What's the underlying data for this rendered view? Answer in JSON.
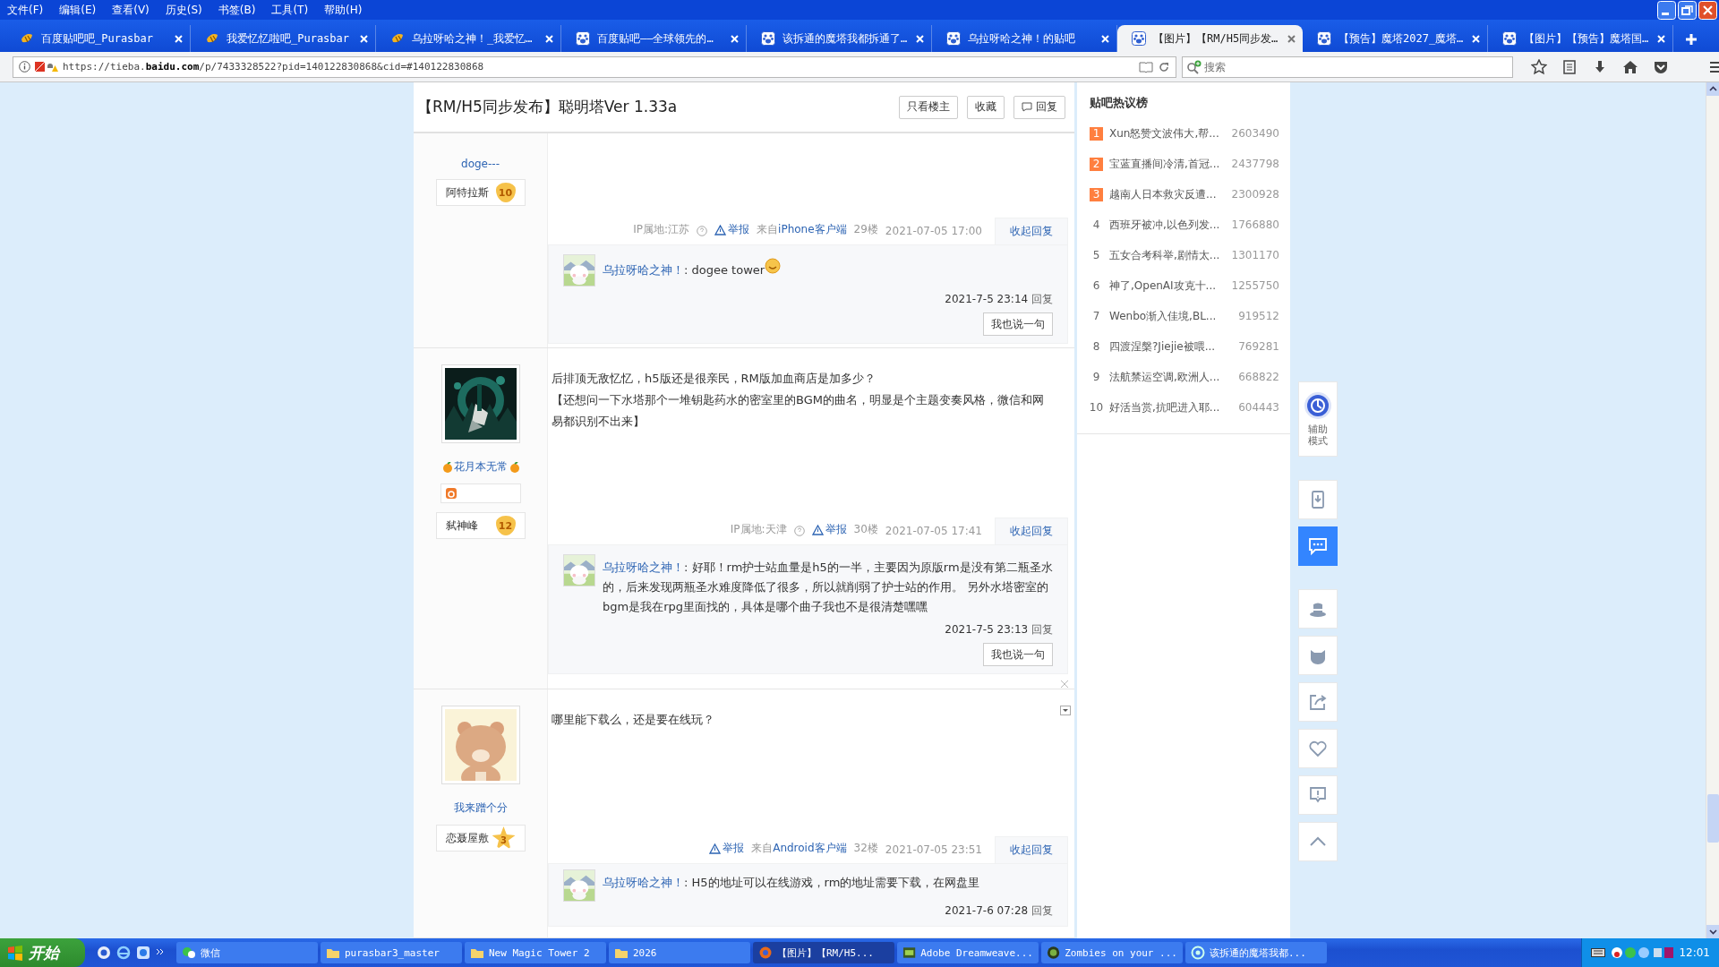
{
  "menu_bar": {
    "items": [
      "文件(F)",
      "编辑(E)",
      "查看(V)",
      "历史(S)",
      "书签(B)",
      "工具(T)",
      "帮助(H)"
    ]
  },
  "tabs": [
    {
      "title": "百度贴吧吧_Purasbar",
      "kind": "bee",
      "selected": false
    },
    {
      "title": "我爱忆忆啦吧_Purasbar",
      "kind": "bee",
      "selected": false
    },
    {
      "title": "乌拉呀哈之神！_我爱忆…",
      "kind": "bee",
      "selected": false
    },
    {
      "title": "百度贴吧——全球领先的…",
      "kind": "paw",
      "selected": false
    },
    {
      "title": "该拆通的魔塔我都拆通了…",
      "kind": "paw",
      "selected": false
    },
    {
      "title": "乌拉呀哈之神！的贴吧",
      "kind": "paw",
      "selected": false
    },
    {
      "title": "【图片】【RM/H5同步发…",
      "kind": "paw",
      "selected": true
    },
    {
      "title": "【预告】魔塔2027_魔塔…",
      "kind": "paw",
      "selected": false
    },
    {
      "title": "【图片】【预告】魔塔国…",
      "kind": "paw",
      "selected": false
    }
  ],
  "nav_bar": {
    "url": "https://tieba.**baidu.com**/p/7433328522?pid=140122830868&cid=#140122830868",
    "search": {
      "placeholder": "搜索"
    }
  },
  "thread": {
    "title": "【RM/H5同步发布】聪明塔Ver 1.33a",
    "buttons": [
      {
        "label": "只看楼主",
        "kind": "text"
      },
      {
        "label": "收藏",
        "kind": "text"
      },
      {
        "label": "回复",
        "kind": "comment"
      }
    ],
    "posts": [
      {
        "author": "doge---",
        "avatar": false,
        "author_decor": false,
        "icon_shelf": false,
        "badge": {
          "name": "阿特拉斯",
          "level": "10",
          "kind": "shield"
        },
        "meta": {
          "ip": "IP属地:江苏",
          "report": "举报",
          "client": {
            "prefix": "来自",
            "name": "iPhone客户端"
          },
          "floor": "29楼",
          "time": "2021-07-05 17:00",
          "toggle": "收起回复"
        },
        "replies": [
          {
            "user": "乌拉呀哈之神！",
            "text": ": dogee tower",
            "emoji": true,
            "time": "2021-7-5 23:14",
            "action": "回复"
          }
        ],
        "comment_button": "我也说一句"
      },
      {
        "author": "花月本无常",
        "avatar": {
          "kind": "picture"
        },
        "author_decor": true,
        "icon_shelf": true,
        "badge": {
          "name": "弑神峰",
          "level": "12",
          "kind": "shield"
        },
        "text": [
          "后排顶无敌忆忆，h5版还是很亲民，RM版加血商店是加多少？",
          "【还想问一下水塔那个一堆钥匙药水的密室里的BGM的曲名，明显是个主题变奏风格，微信和网易都识别不出来】"
        ],
        "meta": {
          "ip": "IP属地:天津",
          "report": "举报",
          "floor": "30楼",
          "time": "2021-07-05 17:41",
          "toggle": "收起回复"
        },
        "replies": [
          {
            "user": "乌拉呀哈之神！",
            "text": ": 好耶！rm护士站血量是h5的一半，主要因为原版rm是没有第二瓶圣水的，后来发现两瓶圣水难度降低了很多，所以就削弱了护士站的作用。 另外水塔密室的bgm是我在rpg里面找的，具体是哪个曲子我也不是很清楚嘿嘿",
            "emoji": false,
            "time": "2021-7-5 23:13",
            "action": "回复"
          }
        ],
        "comment_button": "我也说一句",
        "closable": true
      },
      {
        "author": "我来蹭个分",
        "avatar": {
          "kind": "picture"
        },
        "author_decor": false,
        "icon_shelf": false,
        "badge": {
          "name": "恋聂屋敷",
          "level": "3",
          "kind": "star"
        },
        "text": [
          "哪里能下载么，还是要在线玩？"
        ],
        "menu": true,
        "meta": {
          "report": "举报",
          "client": {
            "prefix": "来自",
            "name": "Android客户端"
          },
          "floor": "32楼",
          "time": "2021-07-05 23:51",
          "toggle": "收起回复"
        },
        "replies": [
          {
            "user": "乌拉呀哈之神！",
            "text": ": H5的地址可以在线游戏，rm的地址需要下载，在网盘里",
            "emoji": false,
            "time": "2021-7-6 07:28",
            "action": "回复"
          }
        ]
      }
    ]
  },
  "hot_list": {
    "title": "贴吧热议榜",
    "items": [
      {
        "rank": "1",
        "title": "Xun怒赞文波伟大,帮...",
        "count": "2603490",
        "top": true
      },
      {
        "rank": "2",
        "title": "宝蓝直播间冷清,首冠...",
        "count": "2437798",
        "top": true
      },
      {
        "rank": "3",
        "title": "越南人日本救灾反遭...",
        "count": "2300928",
        "top": true
      },
      {
        "rank": "4",
        "title": "西班牙被冲,以色列发...",
        "count": "1766880",
        "top": false
      },
      {
        "rank": "5",
        "title": "五女合考科举,剧情太...",
        "count": "1301170",
        "top": false
      },
      {
        "rank": "6",
        "title": "神了,OpenAI攻克十...",
        "count": "1255750",
        "top": false
      },
      {
        "rank": "7",
        "title": "Wenbo渐入佳境,BL...",
        "count": "919512",
        "top": false
      },
      {
        "rank": "8",
        "title": "四渡涅槃?Jiejie被喂...",
        "count": "769281",
        "top": false
      },
      {
        "rank": "9",
        "title": "法航禁运空调,欧洲人...",
        "count": "668822",
        "top": false
      },
      {
        "rank": "10",
        "title": "好活当赏,抗吧进入耶...",
        "count": "604443",
        "top": false
      }
    ]
  },
  "side_toolbar": {
    "items": [
      {
        "kind": "assist",
        "label": "辅助模式",
        "selected": false
      },
      {
        "kind": "phone",
        "selected": false
      },
      {
        "kind": "chat",
        "selected": true
      },
      {
        "kind": "hat",
        "selected": false
      },
      {
        "kind": "cat",
        "selected": false
      },
      {
        "kind": "share",
        "selected": false
      },
      {
        "kind": "heart",
        "selected": false
      },
      {
        "kind": "report",
        "selected": false
      },
      {
        "kind": "up",
        "selected": false
      }
    ]
  },
  "taskbar": {
    "start": "开始",
    "tasks": [
      {
        "label": "微信",
        "kind": "chat",
        "selected": false
      },
      {
        "label": "purasbar3_master",
        "kind": "folder",
        "selected": false
      },
      {
        "label": "New Magic Tower 2",
        "kind": "folder",
        "selected": false
      },
      {
        "label": "2026",
        "kind": "folder",
        "selected": false
      },
      {
        "label": "【图片】【RM/H5...",
        "kind": "browser",
        "selected": true
      },
      {
        "label": "Adobe Dreamweave...",
        "kind": "dw",
        "selected": false
      },
      {
        "label": "Zombies on your ...",
        "kind": "game",
        "selected": false
      },
      {
        "label": "该拆通的魔塔我都...",
        "kind": "web",
        "selected": false
      }
    ],
    "clock": "12:01"
  }
}
